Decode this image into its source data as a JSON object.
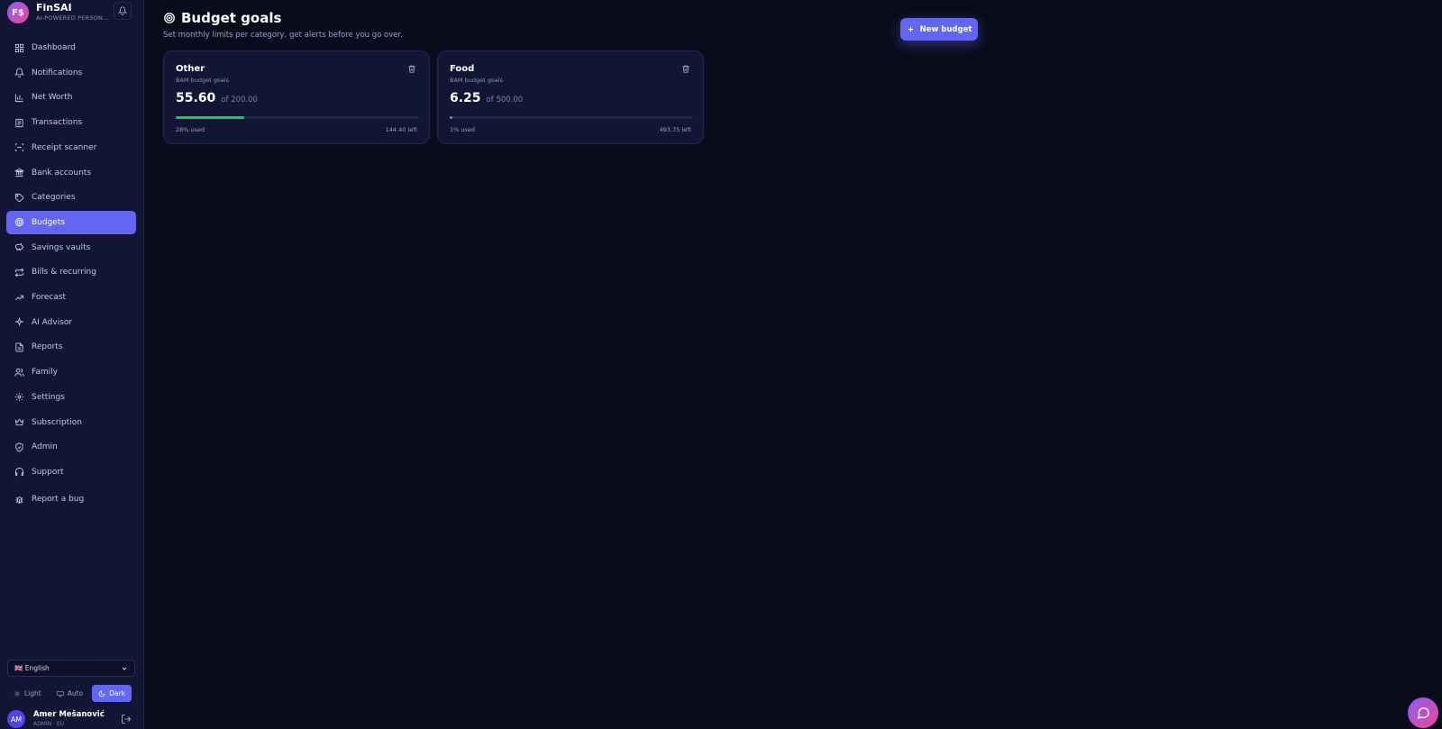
{
  "app": {
    "name": "FinSAI",
    "logo_text": "F$",
    "tagline": "AI-POWERED PERSON..."
  },
  "sidebar": {
    "items": [
      {
        "label": "Dashboard",
        "icon": "grid-icon"
      },
      {
        "label": "Notifications",
        "icon": "bell-icon"
      },
      {
        "label": "Net Worth",
        "icon": "bar-chart-icon"
      },
      {
        "label": "Transactions",
        "icon": "list-icon"
      },
      {
        "label": "Receipt scanner",
        "icon": "scan-icon"
      },
      {
        "label": "Bank accounts",
        "icon": "bank-icon"
      },
      {
        "label": "Categories",
        "icon": "tag-icon"
      },
      {
        "label": "Budgets",
        "icon": "target-icon",
        "active": true
      },
      {
        "label": "Savings vaults",
        "icon": "piggy-bank-icon"
      },
      {
        "label": "Bills & recurring",
        "icon": "repeat-icon"
      },
      {
        "label": "Forecast",
        "icon": "trend-icon"
      },
      {
        "label": "AI Advisor",
        "icon": "sparkle-icon"
      },
      {
        "label": "Reports",
        "icon": "file-icon"
      },
      {
        "label": "Family",
        "icon": "users-icon"
      },
      {
        "label": "Settings",
        "icon": "gear-icon"
      },
      {
        "label": "Subscription",
        "icon": "crown-icon"
      },
      {
        "label": "Admin",
        "icon": "shield-icon"
      },
      {
        "label": "Support",
        "icon": "headset-icon"
      },
      {
        "label": "Report a bug",
        "icon": "bug-icon"
      }
    ],
    "language": {
      "selected": "🇬🇧 English"
    },
    "theme": {
      "light": "Light",
      "auto": "Auto",
      "dark": "Dark",
      "active": "dark"
    },
    "user": {
      "initials": "AM",
      "name": "Amer Mešanović",
      "role": "ADMIN · EU"
    }
  },
  "main": {
    "title": "Budget goals",
    "subtitle": "Set monthly limits per category, get alerts before you go over.",
    "new_button": "New budget",
    "budgets": [
      {
        "name": "Other",
        "sub": "BAM budget goals",
        "spent": "55.60",
        "of": "of 200.00",
        "used_fraction": 0.28,
        "used_label": "28% used",
        "left_label": "144.40 left"
      },
      {
        "name": "Food",
        "sub": "BAM budget goals",
        "spent": "6.25",
        "of": "of 500.00",
        "used_fraction": 0.0125,
        "used_label": "1% used",
        "left_label": "493.75 left"
      }
    ]
  },
  "colors": {
    "accent": "#6366f1",
    "progress": "#22c55e",
    "background": "#0a0c1b",
    "sidebar": "#121634"
  }
}
